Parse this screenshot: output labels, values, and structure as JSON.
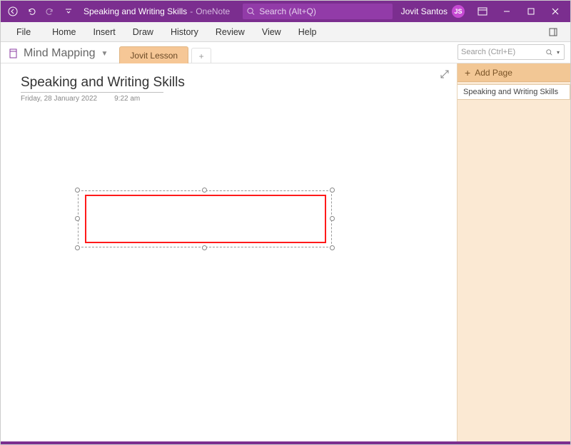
{
  "titlebar": {
    "doc_title": "Speaking and Writing Skills",
    "separator": "-",
    "app_name": "OneNote",
    "search_placeholder": "Search (Alt+Q)",
    "user_name": "Jovit Santos",
    "user_initials": "JS"
  },
  "ribbon": {
    "file": "File",
    "home": "Home",
    "insert": "Insert",
    "draw": "Draw",
    "history": "History",
    "review": "Review",
    "view": "View",
    "help": "Help"
  },
  "notebook": {
    "name": "Mind Mapping",
    "section_tab": "Jovit Lesson",
    "search_placeholder": "Search (Ctrl+E)"
  },
  "page": {
    "title": "Speaking and Writing Skills",
    "date": "Friday, 28 January 2022",
    "time": "9:22 am"
  },
  "pagepanel": {
    "add_label": "Add Page",
    "pages": [
      {
        "label": "Speaking and Writing Skills"
      }
    ]
  }
}
